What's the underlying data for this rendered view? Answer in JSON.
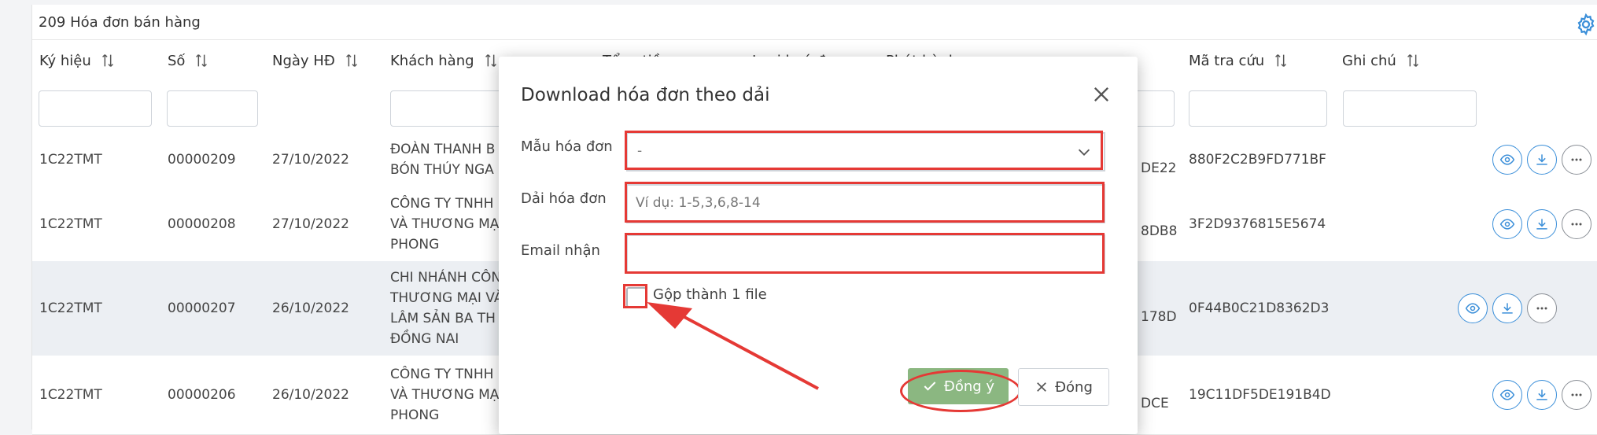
{
  "panel": {
    "title": "209 Hóa đơn bán hàng"
  },
  "columns": {
    "ky_hieu": "Ký hiệu",
    "so": "Số",
    "ngay_hd": "Ngày HĐ",
    "khach_hang": "Khách hàng",
    "tong_tien": "Tổng tiền",
    "loai_hoa_don": "Loại hoá đơn",
    "phat_hanh": "Phát hành",
    "ma_tra_cuu": "Mã tra cứu",
    "ghi_chu": "Ghi chú"
  },
  "rows": [
    {
      "ky_hieu": "1C22TMT",
      "so": "00000209",
      "ngay": "27/10/2022",
      "kh1": "ĐOÀN THANH B",
      "kh2": "BÓN THÚY NGA",
      "kh3": "",
      "kh4": "",
      "ma_frag": "DE22",
      "ma_tra_cuu": "880F2C2B9FD771BF"
    },
    {
      "ky_hieu": "1C22TMT",
      "so": "00000208",
      "ngay": "27/10/2022",
      "kh1": "CÔNG TY TNHH",
      "kh2": "VÀ THƯƠNG MẠ",
      "kh3": "PHONG",
      "kh4": "",
      "ma_frag": "8DB8",
      "ma_tra_cuu": "3F2D9376815E5674"
    },
    {
      "ky_hieu": "1C22TMT",
      "so": "00000207",
      "ngay": "26/10/2022",
      "kh1": "CHI NHÁNH CÔN",
      "kh2": "THƯƠNG MẠI VÀ",
      "kh3": "LÂM SẢN BA TH",
      "kh4": "ĐỒNG NAI",
      "ma_frag": "178D",
      "ma_tra_cuu": "0F44B0C21D8362D3"
    },
    {
      "ky_hieu": "1C22TMT",
      "so": "00000206",
      "ngay": "26/10/2022",
      "kh1": "CÔNG TY TNHH",
      "kh2": "VÀ THƯƠNG MẠ",
      "kh3": "PHONG",
      "kh4": "",
      "ma_frag": "DCE",
      "ma_tra_cuu": "19C11DF5DE191B4D"
    }
  ],
  "modal": {
    "title": "Download hóa đơn theo dải",
    "mau_label": "Mẫu hóa đơn",
    "mau_value": "-",
    "dai_label": "Dải hóa đơn",
    "dai_placeholder": "Ví dụ: 1-5,3,6,8-14",
    "email_label": "Email nhận",
    "gop_label": "Gộp thành 1 file",
    "ok_label": "Đồng ý",
    "cancel_label": "Đóng"
  },
  "colors": {
    "accent": "#3b8fd9",
    "annotation": "#e53935",
    "ok_button": "#8bb781"
  }
}
